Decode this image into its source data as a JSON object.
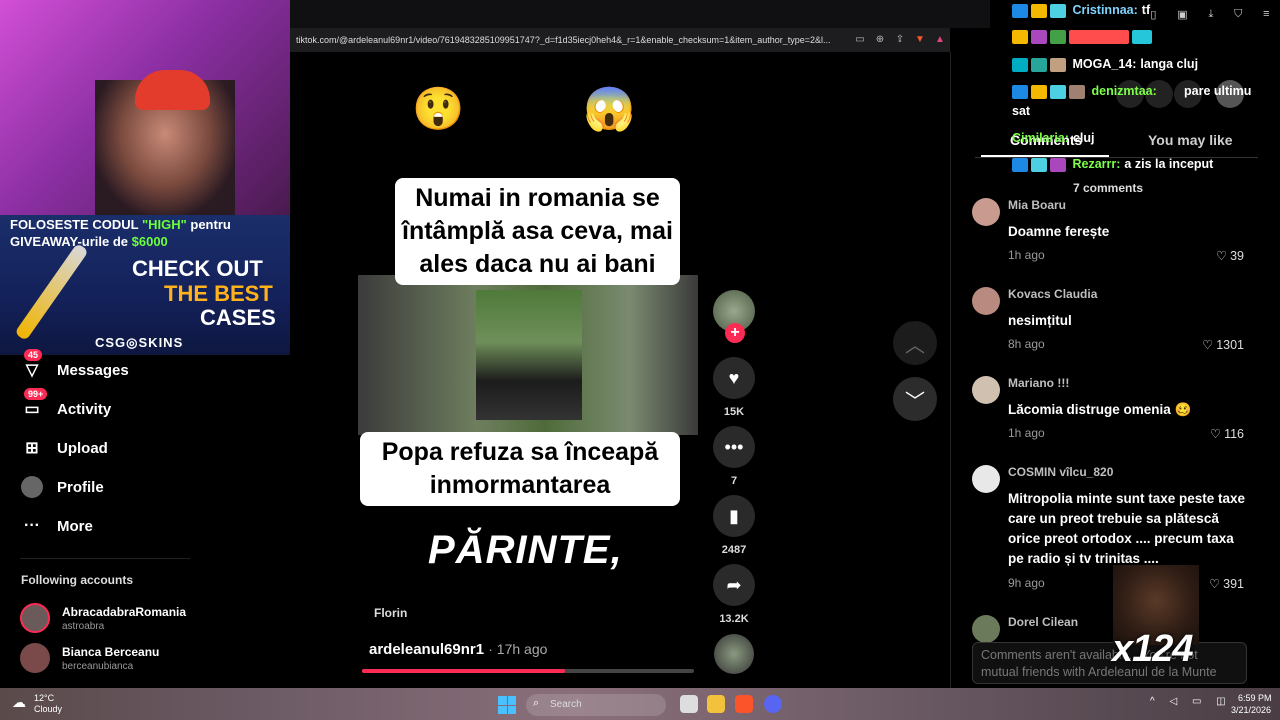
{
  "browser": {
    "url": "tiktok.com/@ardeleanul69nr1/video/7619483285109951747?_d=f1d35iecj0heh4&_r=1&enable_checksum=1&item_author_type=2&l..."
  },
  "sidebar": {
    "items": [
      {
        "label": "Messages",
        "badge": "45"
      },
      {
        "label": "Activity",
        "badge": "99+"
      },
      {
        "label": "Upload",
        "badge": ""
      },
      {
        "label": "Profile",
        "badge": ""
      },
      {
        "label": "More",
        "badge": ""
      }
    ],
    "following_title": "Following accounts",
    "accounts": [
      {
        "name": "AbracadabraRomania",
        "handle": "astroabra"
      },
      {
        "name": "Bianca Berceanu",
        "handle": "berceanubianca"
      }
    ]
  },
  "ad": {
    "line1_pre": "FOLOSESTE CODUL ",
    "line1_hl": "\"HIGH\"",
    "line1_post": " pentru",
    "line2_pre": "GIVEAWAY-urile de ",
    "line2_hl": "$6000",
    "check": "CHECK OUT",
    "best": "THE BEST",
    "cases": "CASES",
    "brand": "CSG◎SKINS"
  },
  "video": {
    "emoji_left": "😲",
    "emoji_right": "😱",
    "caption_top": "Numai in romania se întâmplă asa ceva, mai ales daca nu ai bani",
    "caption_bottom": "Popa refuza sa înceapă inmormantarea",
    "overlay_text": "PĂRINTE,",
    "speaker": "Florin",
    "author": "ardeleanul69nr1",
    "time_ago": "· 17h ago",
    "progress": 0.61
  },
  "actions": {
    "likes": "15K",
    "comments": "7",
    "saves": "2487",
    "shares": "13.2K"
  },
  "panel": {
    "tab_comments": "Comments",
    "tab_like": "You may like",
    "comment_count": "7 comments",
    "comments": [
      {
        "user": "Mia Boaru",
        "text": "Doamne ferește",
        "ago": "1h ago",
        "likes": "39"
      },
      {
        "user": "Kovacs Claudia",
        "text": "nesimțitul",
        "ago": "8h ago",
        "likes": "1301"
      },
      {
        "user": "Mariano !!!",
        "text": "Lăcomia distruge omenia 🥴",
        "ago": "1h ago",
        "likes": "116"
      },
      {
        "user": "COSMIN vîlcu_820",
        "text": "Mitropolia minte sunt taxe peste taxe care un preot trebuie sa plătescă orice preot ortodox .... precum taxa pe radio și tv trinitas ....",
        "ago": "9h ago",
        "likes": "391"
      },
      {
        "user": "Dorel Cilean",
        "text": "",
        "ago": "",
        "likes": ""
      }
    ],
    "notice": "Comments aren't available... You're not mutual friends with Ardeleanul de la Munte"
  },
  "chat": [
    {
      "user": "Cristinnaa:",
      "msg": "tf",
      "color": "#7fd4ff"
    },
    {
      "user": "",
      "msg": "",
      "color": "#ff4d4d"
    },
    {
      "user": "MOGA_14:",
      "msg": "langa cluj",
      "color": "#ffffff"
    },
    {
      "user": "denizmtaa:",
      "msg": "pare ultimu",
      "color": "#7dff4a"
    },
    {
      "user": "",
      "msg": "sat",
      "color": "#ffffff"
    },
    {
      "user": "Cimilaria:",
      "msg": "cluj",
      "color": "#7dff4a"
    },
    {
      "user": "Rezarrr:",
      "msg": "a zis la inceput",
      "color": "#7dff4a"
    }
  ],
  "reaction": {
    "multiplier": "x124"
  },
  "taskbar": {
    "temp": "12°C",
    "condition": "Cloudy",
    "search": "Search",
    "time": "6:59 PM",
    "date": "3/21/2026"
  },
  "colors": {
    "accent": "#fe2c55",
    "chat_green": "#7dff4a",
    "chat_blue": "#7fd4ff"
  }
}
